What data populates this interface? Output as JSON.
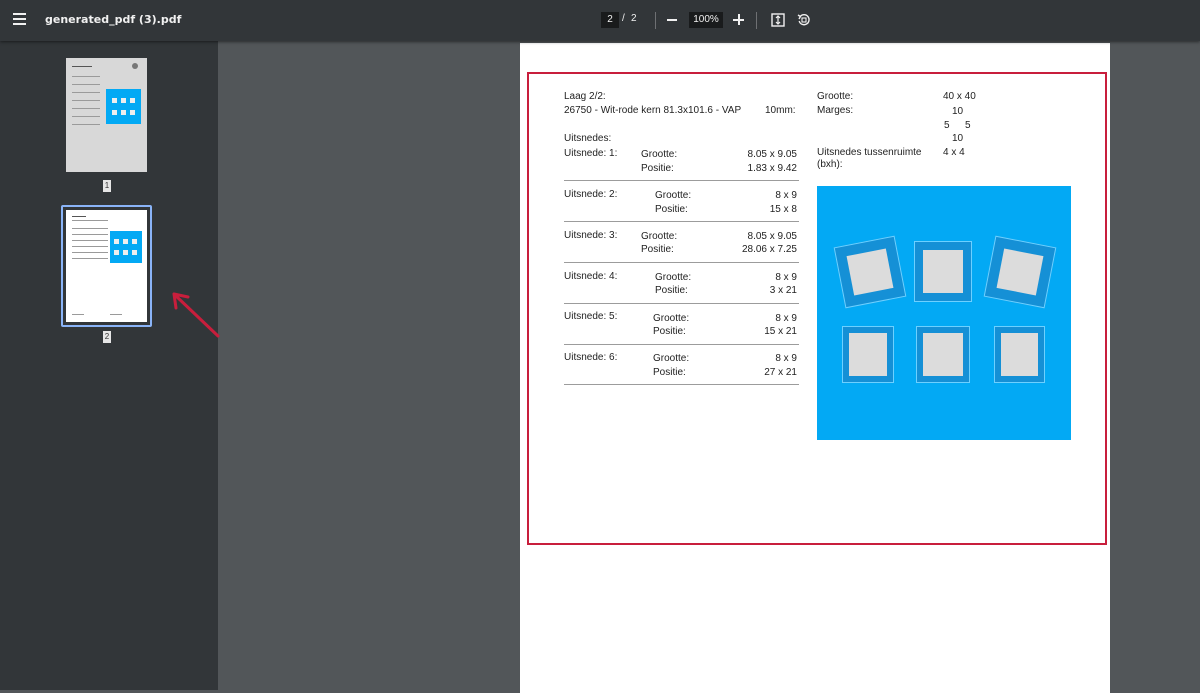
{
  "toolbar": {
    "title": "generated_pdf (3).pdf",
    "current_page": "2",
    "page_separator": "/",
    "total_pages": "2",
    "zoom": "100%"
  },
  "sidebar": {
    "thumbnails": [
      {
        "label": "1"
      },
      {
        "label": "2",
        "selected": true
      }
    ]
  },
  "page": {
    "layer_heading": "Laag 2/2:",
    "layer_desc": "26750 - Wit-rode kern 81.3x101.6 - VAP",
    "layer_thickness": "10mm:",
    "cutouts_heading": "Uitsnedes:",
    "cutouts": [
      {
        "label": "Uitsnede: 1:",
        "size_label": "Grootte:",
        "size": "8.05 x 9.05",
        "pos_label": "Positie:",
        "pos": "1.83 x 9.42"
      },
      {
        "label": "Uitsnede: 2:",
        "size_label": "Grootte:",
        "size": "8 x 9",
        "pos_label": "Positie:",
        "pos": "15 x 8"
      },
      {
        "label": "Uitsnede: 3:",
        "size_label": "Grootte:",
        "size": "8.05 x 9.05",
        "pos_label": "Positie:",
        "pos": "28.06 x 7.25"
      },
      {
        "label": "Uitsnede: 4:",
        "size_label": "Grootte:",
        "size": "8 x 9",
        "pos_label": "Positie:",
        "pos": "3 x 21"
      },
      {
        "label": "Uitsnede: 5:",
        "size_label": "Grootte:",
        "size": "8 x 9",
        "pos_label": "Positie:",
        "pos": "15 x 21"
      },
      {
        "label": "Uitsnede: 6:",
        "size_label": "Grootte:",
        "size": "8 x 9",
        "pos_label": "Positie:",
        "pos": "27 x 21"
      }
    ],
    "right": {
      "size_label": "Grootte:",
      "size_value": "40 x 40",
      "margins_label": "Marges:",
      "margin_top": "10",
      "margin_left": "5",
      "margin_right": "5",
      "margin_bottom": "10",
      "spacing_label_1": "Uitsnedes tussenruimte",
      "spacing_label_2": "(bxh):",
      "spacing_value": "4 x 4"
    }
  },
  "colors": {
    "preview_blue": "#03a9f4",
    "highlight_red": "#c81e3c",
    "selected_thumb_border": "#8ab4f8"
  },
  "icons": [
    "menu-icon",
    "zoom-out-icon",
    "zoom-in-icon",
    "fit-page-icon",
    "rotate-icon",
    "annotation-arrow-icon"
  ]
}
